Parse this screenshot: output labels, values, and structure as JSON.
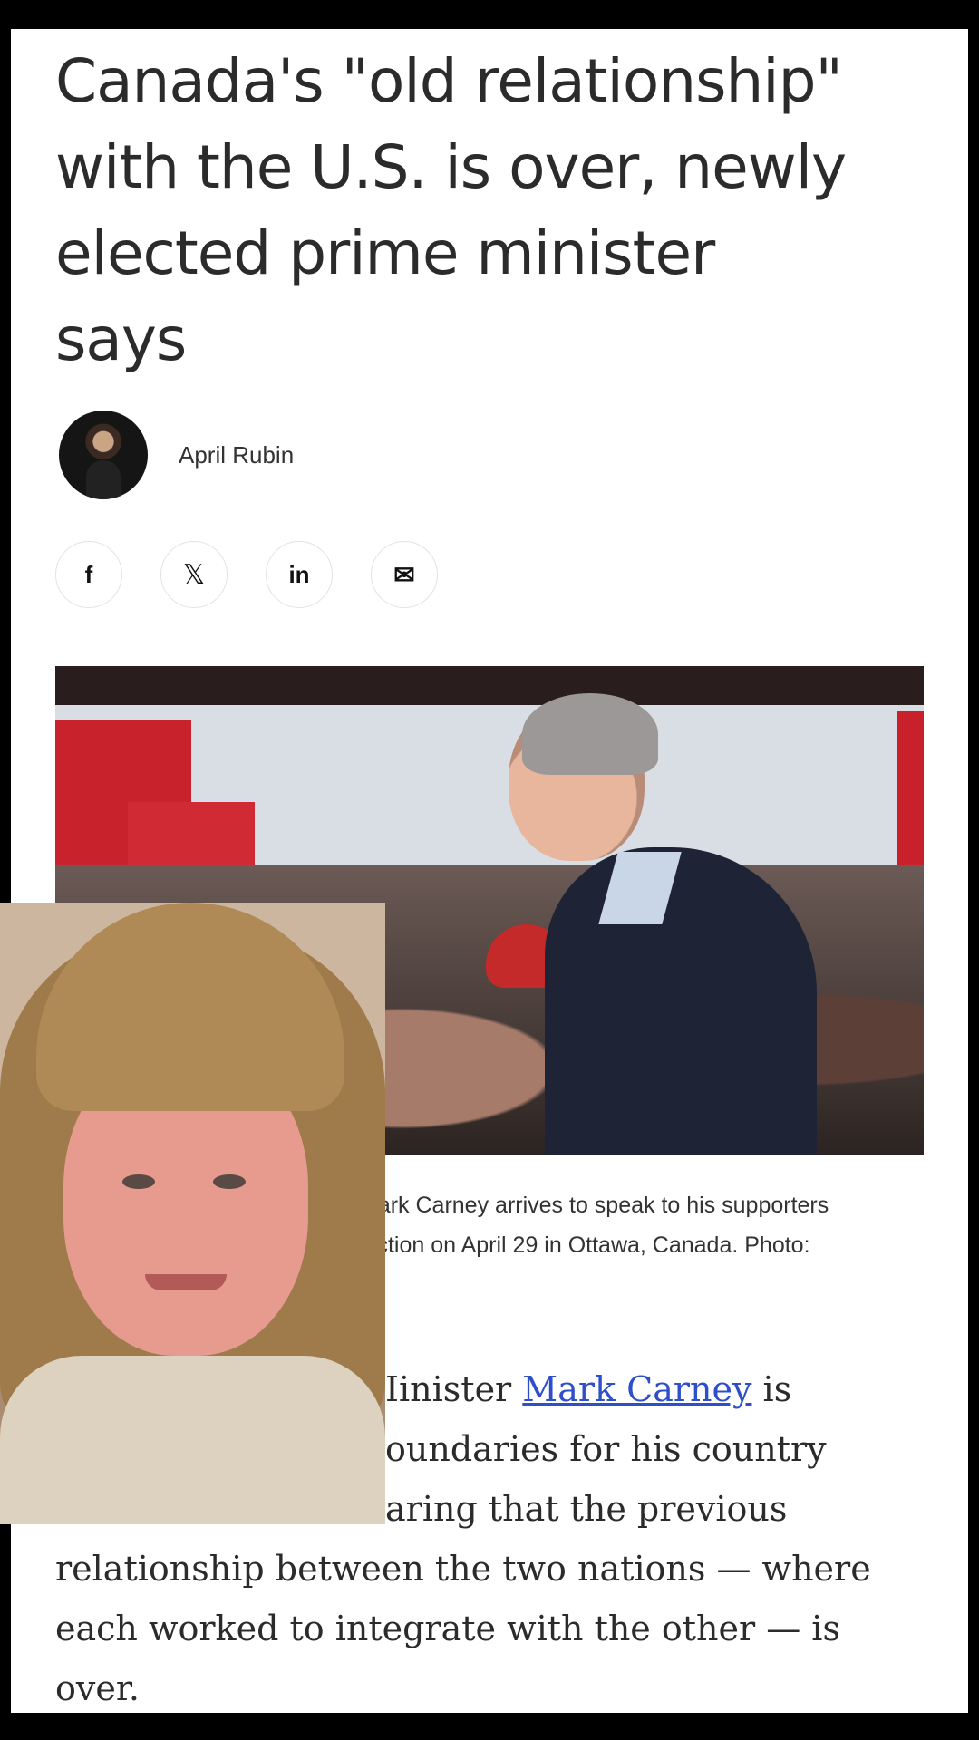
{
  "article": {
    "headline_lines": [
      "Canada's \"old relationship\"",
      "with the U.S. is over, newly",
      "elected prime minister",
      "says"
    ],
    "author": "April Rubin"
  },
  "share": {
    "facebook": "f",
    "x": "𝕏",
    "linkedin": "in",
    "email": "✉"
  },
  "photo": {
    "caption_lines": [
      "Mark Carney arrives to speak to his supporters",
      "lection on April 29 in Ottawa, Canada. Photo:"
    ]
  },
  "body": {
    "line1_pre": "Iinister ",
    "line1_link": "Mark Carney",
    "line1_post": " is",
    "line2": "oundaries for his country",
    "line3": "aring that the previous",
    "line4": "relationship between the two nations — where",
    "line5": "each worked to integrate with the other — is",
    "line6": "over."
  }
}
